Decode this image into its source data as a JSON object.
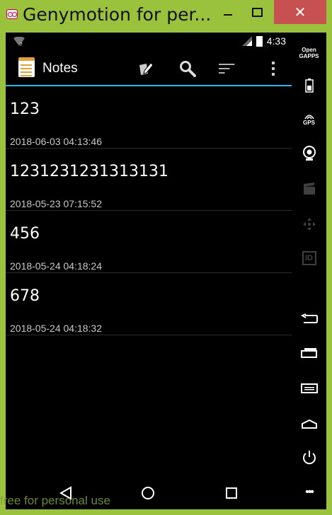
{
  "window": {
    "title": "Genymotion for per...",
    "minimize_label": "",
    "maximize_label": "",
    "close_label": "✕"
  },
  "statusbar": {
    "time": "4:33"
  },
  "actionbar": {
    "title": "Notes",
    "icons": [
      "new-note-icon",
      "search-icon",
      "sort-icon",
      "overflow-menu-icon"
    ]
  },
  "notes": [
    {
      "title": "123",
      "date": "2018-06-03 04:13:46"
    },
    {
      "title": "1231231231313131",
      "date": "2018-05-23 07:15:52"
    },
    {
      "title": "456",
      "date": "2018-05-24 04:18:24"
    },
    {
      "title": "678",
      "date": "2018-05-24 04:18:32"
    }
  ],
  "sidebar": {
    "opengapps_line1": "Open",
    "opengapps_line2": "GAPPS",
    "gps_label": "GPS",
    "id_label": "ID",
    "more_label": "•••"
  },
  "watermark": "free for personal use",
  "colors": {
    "frame": "#9bc23c",
    "close": "#c75050",
    "accent": "#33b5e5"
  }
}
